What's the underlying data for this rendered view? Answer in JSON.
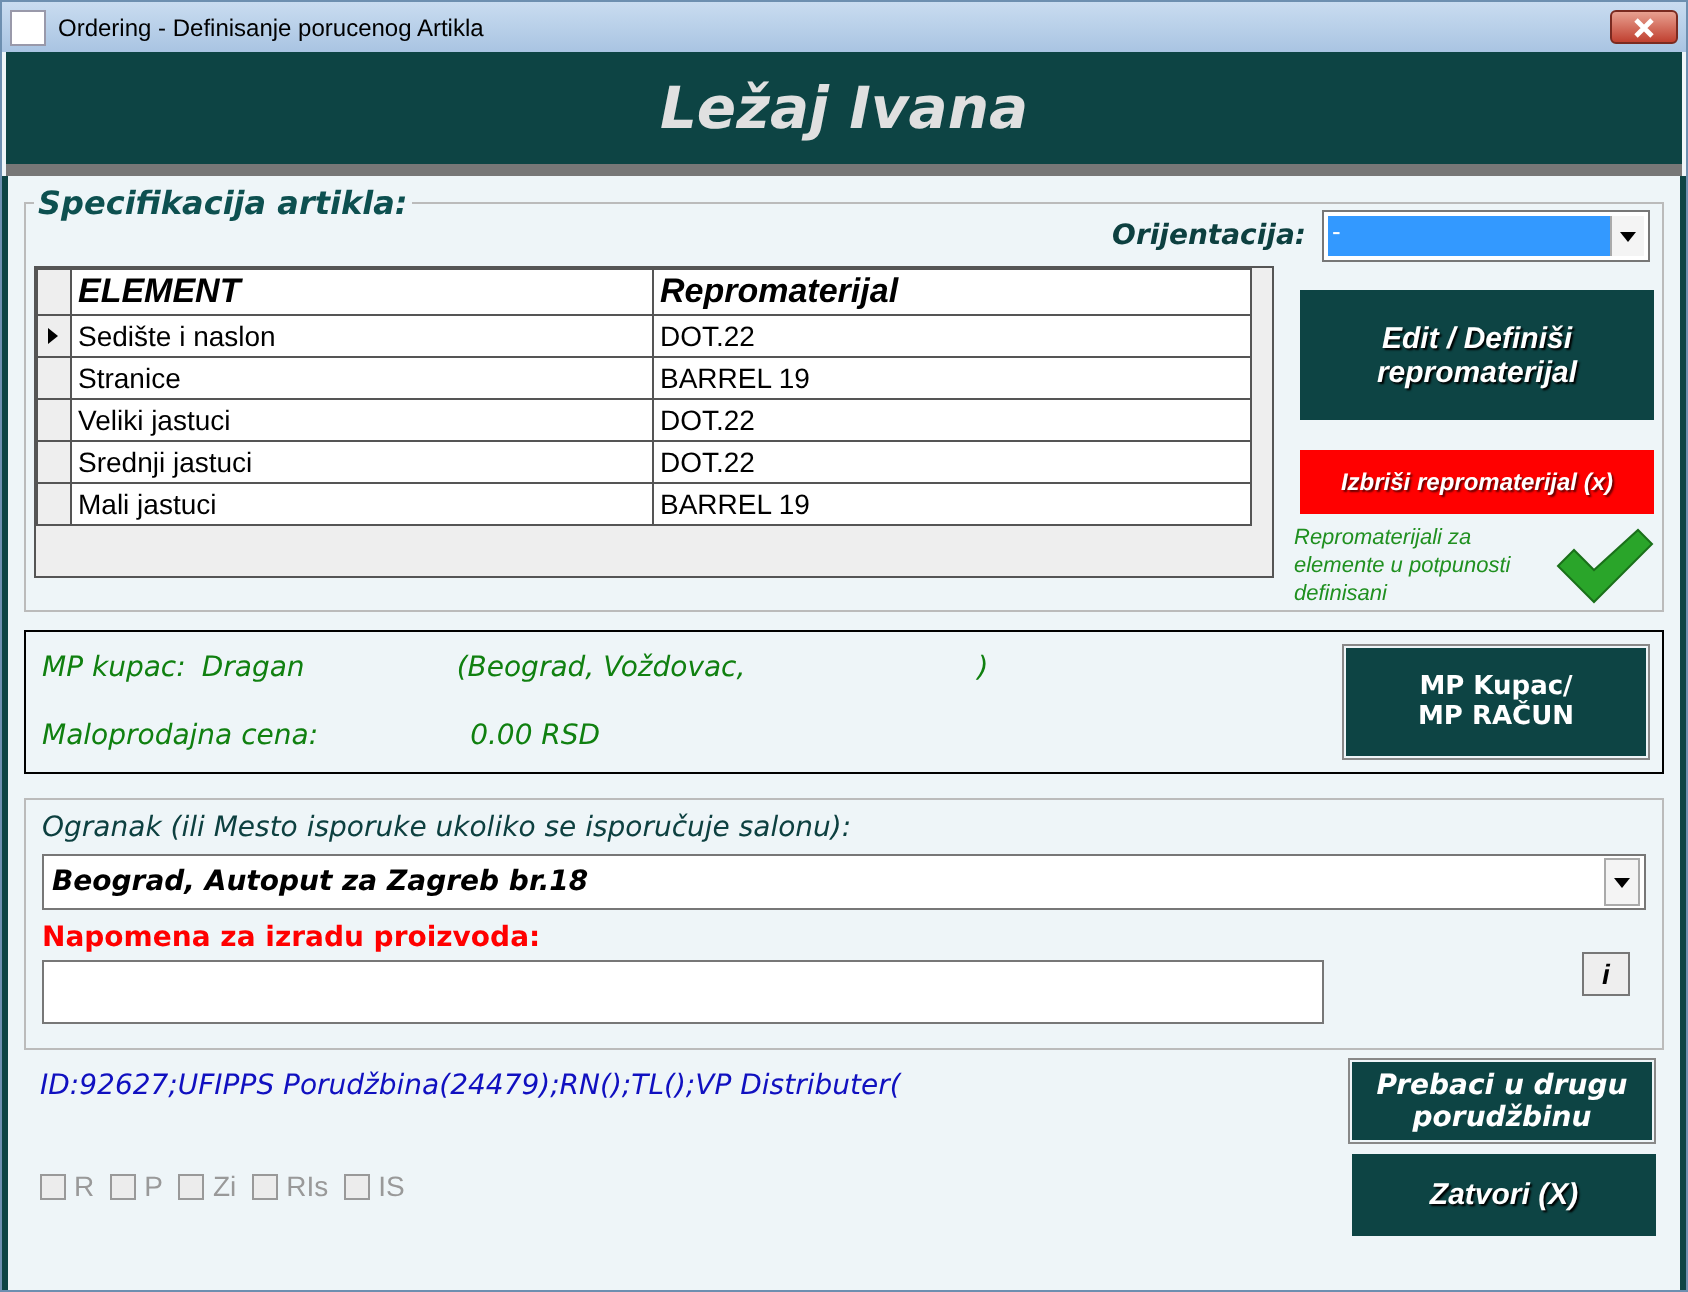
{
  "window": {
    "title": "Ordering - Definisanje porucenog Artikla"
  },
  "header": {
    "title": "Ležaj Ivana"
  },
  "specification": {
    "legend": "Specifikacija artikla:",
    "orientation": {
      "label": "Orijentacija:",
      "value": "-"
    },
    "columns": [
      "ELEMENT",
      "Repromaterijal"
    ],
    "rows": [
      {
        "element": "Sedište i naslon",
        "material": "DOT.22",
        "selected": true
      },
      {
        "element": "Stranice",
        "material": "BARREL 19",
        "selected": false
      },
      {
        "element": "Veliki jastuci",
        "material": "DOT.22",
        "selected": false
      },
      {
        "element": "Srednji jastuci",
        "material": "DOT.22",
        "selected": false
      },
      {
        "element": "Mali jastuci",
        "material": "BARREL 19",
        "selected": false
      }
    ],
    "edit_button": "Edit / Definiši repromaterijal",
    "delete_button": "Izbriši repromaterijal (x)",
    "status": {
      "text": "Repromaterijali za elemente u potpunosti definisani",
      "complete": true
    }
  },
  "customer": {
    "label": "MP kupac:",
    "name": "Dragan",
    "address_start": "(Beograd, Voždovac,",
    "address_end": ")",
    "price_label": "Maloprodajna cena:",
    "price": "0.00 RSD",
    "button": "MP Kupac/ MP RAČUN"
  },
  "delivery": {
    "label": "Ogranak (ili Mesto isporuke ukoliko se isporučuje salonu):",
    "value": "Beograd, Autoput za Zagreb br.18",
    "note_label": "Napomena za izradu proizvoda:",
    "info_button": "i"
  },
  "footer": {
    "info": "ID:92627;UFIPPS Porudžbina(24479);RN();TL();VP Distributer(",
    "flags": [
      {
        "label": "R",
        "checked": false,
        "disabled": true
      },
      {
        "label": "P",
        "checked": false,
        "disabled": true
      },
      {
        "label": "Zi",
        "checked": false,
        "disabled": true
      },
      {
        "label": "RIs",
        "checked": false,
        "disabled": true
      },
      {
        "label": "IS",
        "checked": false,
        "disabled": true
      }
    ],
    "move_button": "Prebaci u drugu porudžbinu",
    "close_button": "Zatvori (X)"
  }
}
